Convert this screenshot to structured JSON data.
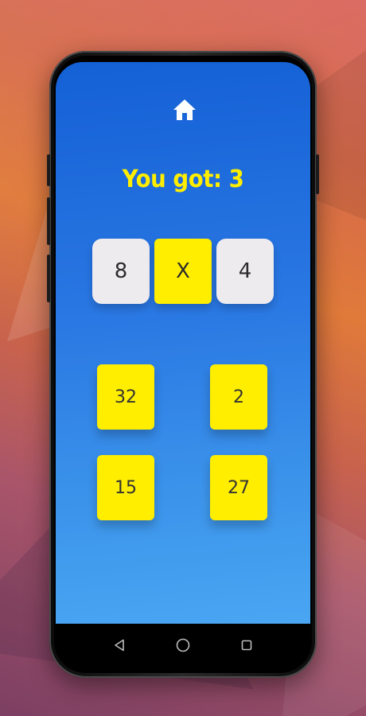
{
  "game": {
    "score_text": "You got: 3",
    "equation": {
      "left_operand": "8",
      "operator": "X",
      "right_operand": "4"
    },
    "answers": [
      "32",
      "2",
      "15",
      "27"
    ]
  },
  "colors": {
    "accent_yellow": "#ffee00",
    "screen_blue_top": "#1460d6",
    "screen_blue_bottom": "#4aa6f3",
    "operand_tile": "#eeebee"
  },
  "icons": {
    "home": "home-icon",
    "back": "back-triangle-icon",
    "home_nav": "home-circle-icon",
    "recents": "recents-square-icon"
  }
}
